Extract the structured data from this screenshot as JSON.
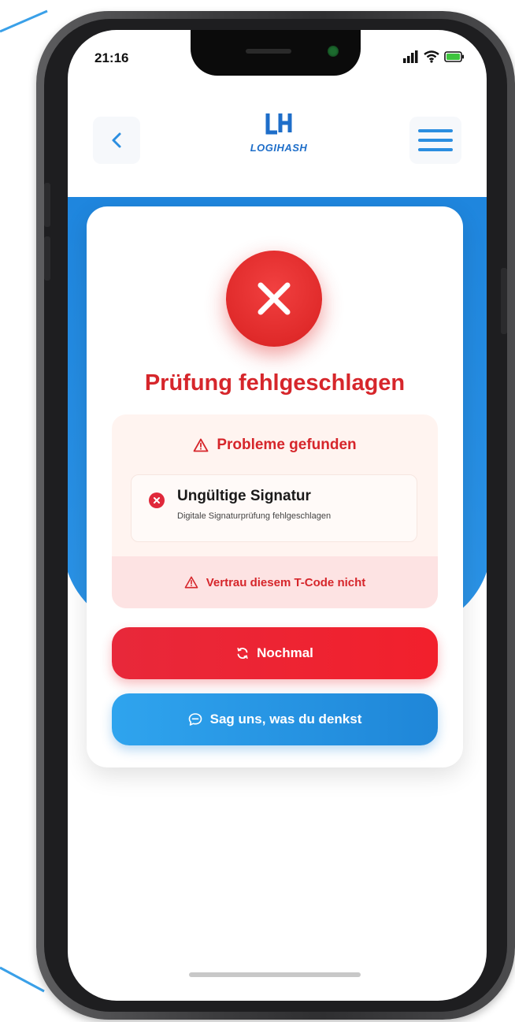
{
  "status_bar": {
    "time": "21:16",
    "icons": [
      "signal-bars-icon",
      "wifi-icon",
      "battery-icon"
    ]
  },
  "header": {
    "back_icon": "chevron-left-icon",
    "logo_text": "LOGIHASH",
    "menu_icon": "hamburger-menu-icon"
  },
  "result": {
    "status_icon": "x-close-icon",
    "title": "Prüfung fehlgeschlagen",
    "problems_heading": "Probleme gefunden",
    "issues": [
      {
        "title": "Ungültige Signatur",
        "description": "Digitale Signaturprüfung fehlgeschlagen"
      }
    ],
    "warning": "Vertrau diesem T-Code nicht"
  },
  "actions": {
    "retry_label": "Nochmal",
    "feedback_label": "Sag uns, was du denkst"
  },
  "colors": {
    "accent_blue": "#2b93e6",
    "error_red": "#e02a2a",
    "title_red": "#d6262b",
    "logo_blue": "#1e6ec9"
  }
}
